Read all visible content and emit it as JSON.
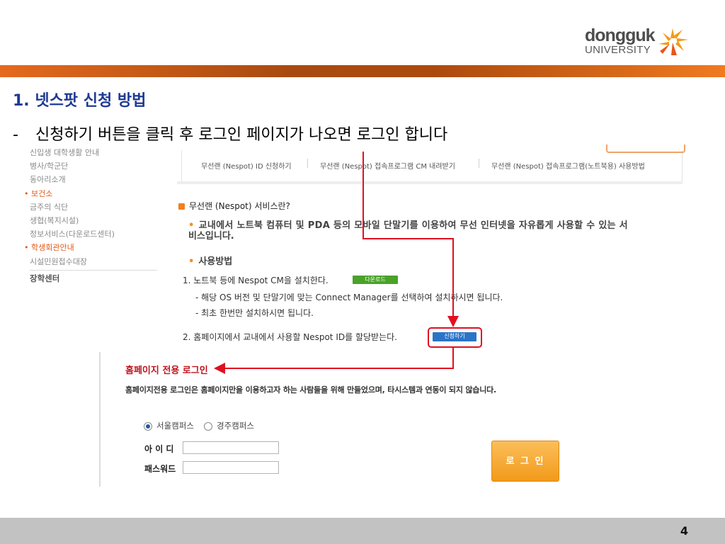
{
  "header": {
    "logo_top": "dongguk",
    "logo_bottom": "UNIVERSITY",
    "accent_color": "#e46a1e"
  },
  "slide": {
    "title": "1. 넷스팟 신청 방법",
    "bullet_dash": "-",
    "bullet_text": "신청하기 버튼을 클릭 후 로그인 페이지가 나오면 로그인 합니다"
  },
  "left_menu": {
    "items": [
      {
        "label": "신입생 대학생활 안내",
        "active": false
      },
      {
        "label": "병사/학군단",
        "active": false
      },
      {
        "label": "동아리소개",
        "active": false
      },
      {
        "label": "보건소",
        "active": true
      },
      {
        "label": "금주의 식단",
        "active": false
      },
      {
        "label": "생협(복지시설)",
        "active": false
      },
      {
        "label": "정보서비스(다운로드센터)",
        "active": false
      },
      {
        "label": "학생회관안내",
        "active": true
      },
      {
        "label": "시설민원접수대장",
        "active": false
      }
    ],
    "section": "장학센터"
  },
  "tabs": {
    "items": [
      "무선랜 (Nespot) ID 신청하기",
      "무선랜 (Nespot) 접속프로그램 CM 내려받기",
      "무선랜 (Nespot) 접속프로그램(노트북용) 사용방법"
    ]
  },
  "content": {
    "heading": "무선랜 (Nespot) 서비스란?",
    "intro_line1": "교내에서 노트북 컴퓨터 및 PDA 등의 모바일 단말기를 이용하여 무선 인터넷을 자유롭게 사용할 수 있는 서",
    "intro_line2": "비스입니다.",
    "usage_heading": "사용방법",
    "step1": "1. 노트북 등에 Nespot CM을 설치한다.",
    "download_label": "다운로드",
    "step1_note1": "- 해당 OS 버전 및 단말기에 맞는 Connect Manager를 선택하여 설치하시면 됩니다.",
    "step1_note2": "- 최초 한번만 설치하시면 됩니다.",
    "step2": "2. 홈페이지에서 교내에서 사용할 Nespot ID를 할당받는다.",
    "apply_label": "신청하기"
  },
  "login": {
    "title": "홈페이지 전용 로그인",
    "description": "홈페이지전용 로그인은 홈페이지만을 이용하고자 하는 사람들을 위해 만들었으며, 타시스템과 연동이 되지 않습니다.",
    "campus_options": [
      "서울캠퍼스",
      "경주캠퍼스"
    ],
    "selected_campus": "서울캠퍼스",
    "id_label": "아 이 디",
    "password_label": "패스워드",
    "id_value": "",
    "password_value": "",
    "button_label": "로 그 인",
    "highlight_color": "#e01020"
  },
  "footer": {
    "page_number": "4"
  }
}
